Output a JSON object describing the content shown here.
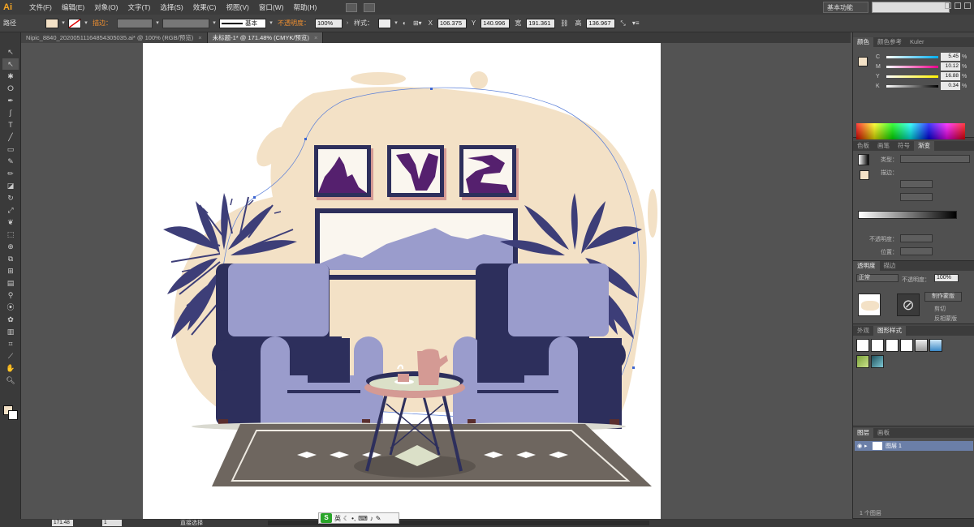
{
  "menubar": {
    "logo": "Ai",
    "items": [
      "文件(F)",
      "编辑(E)",
      "对象(O)",
      "文字(T)",
      "选择(S)",
      "效果(C)",
      "视图(V)",
      "窗口(W)",
      "帮助(H)"
    ],
    "workspace": "基本功能"
  },
  "controlbar": {
    "path_label": "路径",
    "stroke_label": "描边：",
    "stroke_style": "基本",
    "opacity_label": "不透明度：",
    "opacity_value": "100%",
    "style_label": "样式：",
    "x_value": "106.375",
    "y_value": "140.996",
    "w_value": "191.361",
    "h_value": "136.967"
  },
  "tabs": [
    {
      "label": "Nipic_8840_20200511164854305035.ai* @ 100% (RGB/预览)"
    },
    {
      "label": "未标题-1* @ 171.48% (CMYK/预览)"
    }
  ],
  "tools": [
    "pointer",
    "direct-select",
    "magic-wand",
    "lasso",
    "pen",
    "curvature",
    "type",
    "line",
    "rectangle",
    "paintbrush",
    "pencil",
    "eraser",
    "rotate",
    "scale",
    "warp",
    "free-transform",
    "shape-builder",
    "perspective",
    "mesh",
    "gradient",
    "eyedropper",
    "blend",
    "symbol-sprayer",
    "column-graph",
    "artboard",
    "slice",
    "hand",
    "zoom"
  ],
  "color_panel": {
    "tabs": [
      "颜色",
      "颜色参考",
      "Kuler"
    ],
    "channels": [
      {
        "label": "C",
        "value": "5.45",
        "color": "#00aeef"
      },
      {
        "label": "M",
        "value": "10.12",
        "color": "#ec008c"
      },
      {
        "label": "Y",
        "value": "16.88",
        "color": "#fff200"
      },
      {
        "label": "K",
        "value": "0.34",
        "color": "#000000"
      }
    ],
    "pct": "%"
  },
  "gradient_panel": {
    "tabs": [
      "色板",
      "画笔",
      "符号",
      "渐变"
    ],
    "type_label": "类型：",
    "stroke_label": "描边：",
    "opacity_label": "不透明度：",
    "position_label": "位置："
  },
  "transparency_panel": {
    "tabs": [
      "透明度",
      "描边"
    ],
    "mode": "正常",
    "opacity_label": "不透明度：",
    "opacity_value": "100%",
    "make_mask": "制作蒙版",
    "clip": "剪切",
    "invert": "反相蒙版"
  },
  "styles_panel": {
    "tabs": [
      "外观",
      "图形样式"
    ]
  },
  "layers_panel": {
    "tabs": [
      "图层",
      "画板"
    ],
    "layer_name": "图层 1",
    "count": "1 个图层"
  },
  "statusbar": {
    "zoom": "171.48",
    "page": "1",
    "tool": "直接选择"
  },
  "ime": {
    "label": "英"
  },
  "colors": {
    "fill": "#f3e1c6",
    "wall": "#f3e1c6",
    "navy": "#2d2f5c",
    "lavender": "#9a9ccc",
    "purple": "#55206e",
    "rug": "#6e665f",
    "rose": "#d49a94"
  }
}
